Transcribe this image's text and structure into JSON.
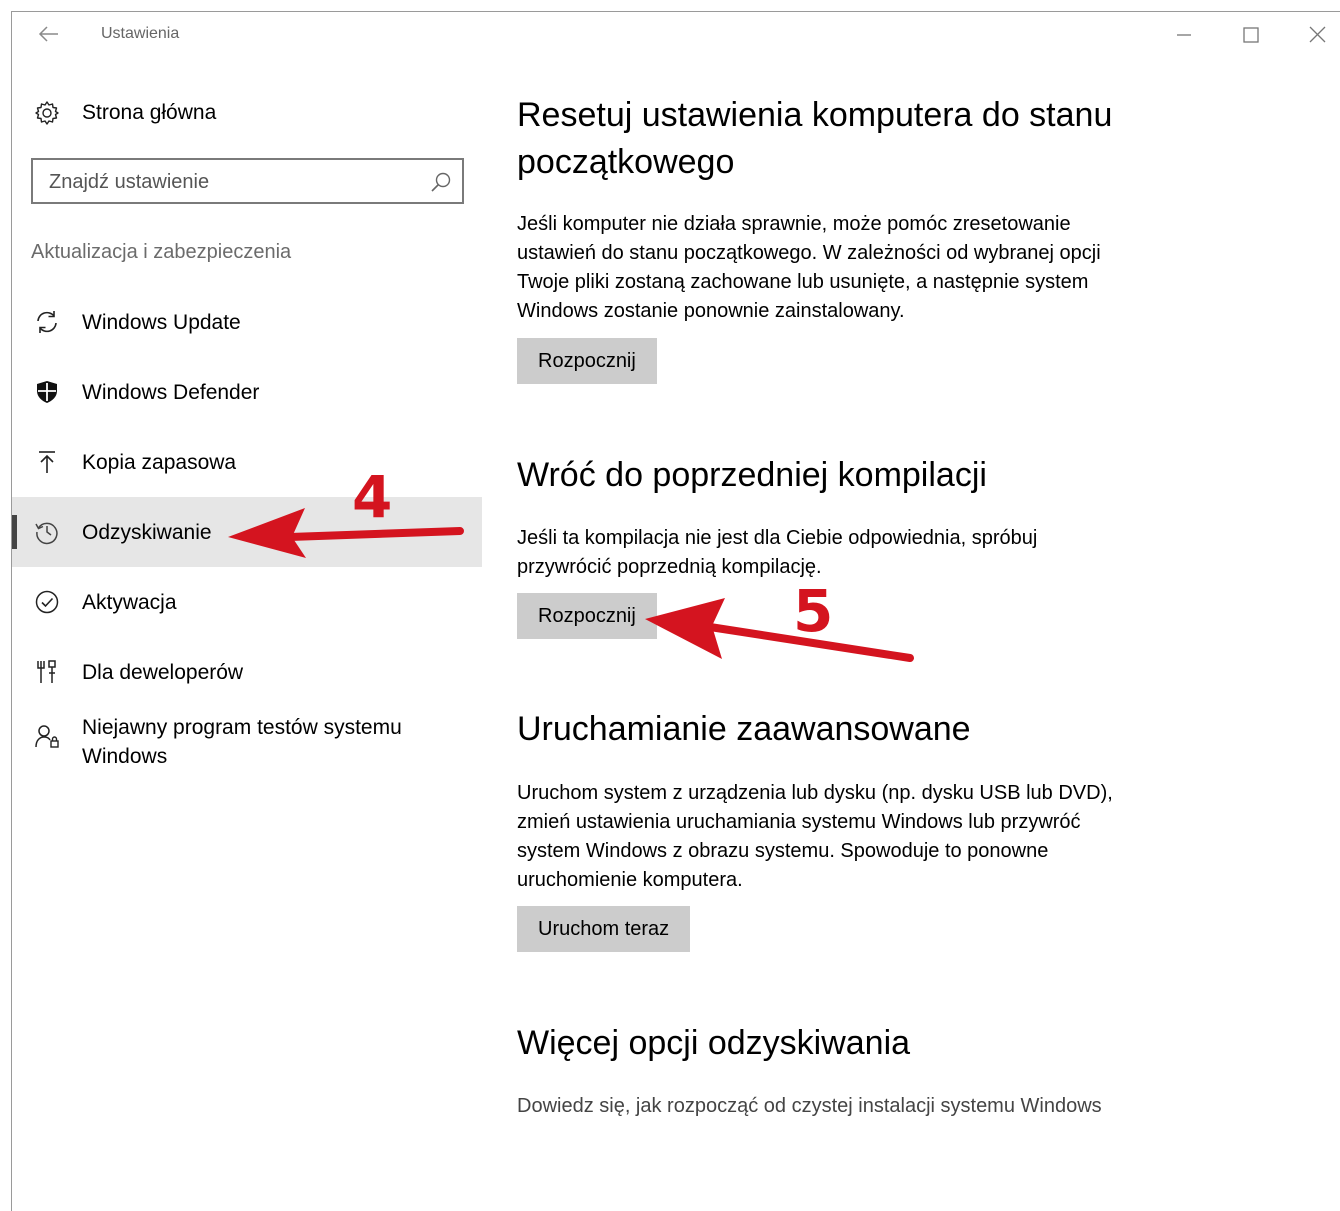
{
  "window": {
    "title": "Ustawienia",
    "controls": [
      "minimize-icon",
      "maximize-icon",
      "close-icon"
    ]
  },
  "sidebar": {
    "home_label": "Strona główna",
    "search_placeholder": "Znajdź ustawienie",
    "section_title": "Aktualizacja i zabezpieczenia",
    "items": [
      {
        "label": "Windows Update",
        "icon": "sync-icon",
        "active": false
      },
      {
        "label": "Windows Defender",
        "icon": "shield-icon",
        "active": false
      },
      {
        "label": "Kopia zapasowa",
        "icon": "upload-arrow-icon",
        "active": false
      },
      {
        "label": "Odzyskiwanie",
        "icon": "history-icon",
        "active": true
      },
      {
        "label": "Aktywacja",
        "icon": "check-circle-icon",
        "active": false
      },
      {
        "label": "Dla deweloperów",
        "icon": "developer-tools-icon",
        "active": false
      },
      {
        "label": "Niejawny program testów systemu Windows",
        "label_line1": "Niejawny program testów systemu",
        "label_line2": "Windows",
        "icon": "insider-icon",
        "active": false
      }
    ]
  },
  "main": {
    "reset": {
      "title_line1": "Resetuj ustawienia komputera do stanu",
      "title_line2": "początkowego",
      "desc_lines": [
        "Jeśli komputer nie działa sprawnie, może pomóc zresetowanie",
        "ustawień do stanu początkowego. W zależności od wybranej opcji",
        "Twoje pliki zostaną zachowane lub usunięte, a następnie system",
        "Windows zostanie ponownie zainstalowany."
      ],
      "button": "Rozpocznij"
    },
    "rollback": {
      "title": "Wróć do poprzedniej kompilacji",
      "desc_lines": [
        "Jeśli ta kompilacja nie jest dla Ciebie odpowiednia, spróbuj",
        "przywrócić poprzednią kompilację."
      ],
      "button": "Rozpocznij"
    },
    "advanced": {
      "title": "Uruchamianie zaawansowane",
      "desc_lines": [
        "Uruchom system z urządzenia lub dysku (np. dysku USB lub DVD),",
        "zmień ustawienia uruchamiania systemu Windows lub przywróć",
        "system Windows z obrazu systemu. Spowoduje to ponowne",
        "uruchomienie komputera."
      ],
      "button": "Uruchom teraz"
    },
    "more": {
      "title": "Więcej opcji odzyskiwania",
      "link": "Dowiedz się, jak rozpocząć od czystej instalacji systemu Windows"
    }
  },
  "annotations": {
    "step4": "4",
    "step5": "5",
    "arrow_color": "#d4141f"
  }
}
